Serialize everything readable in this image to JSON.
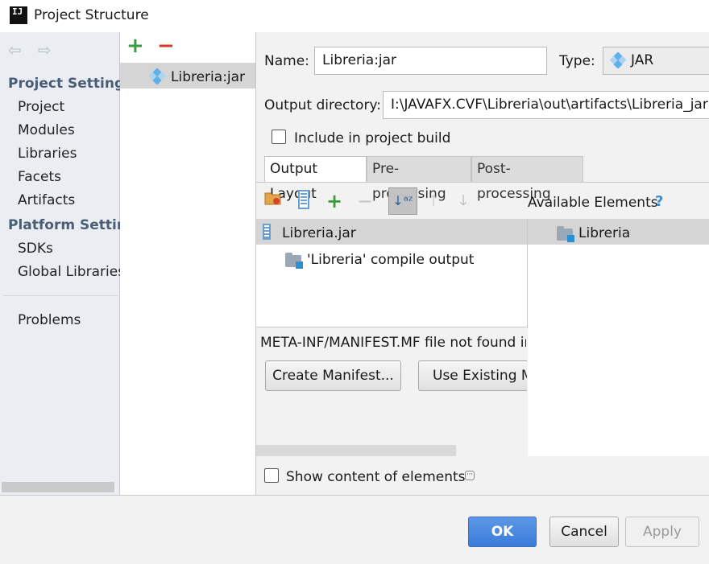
{
  "window": {
    "title": "Project Structure",
    "icon_text": "IJ"
  },
  "nav": {
    "back_icon": "arrow-left-icon",
    "forward_icon": "arrow-right-icon",
    "project_settings_title": "Project Settings",
    "project_settings_items": [
      "Project",
      "Modules",
      "Libraries",
      "Facets",
      "Artifacts"
    ],
    "platform_settings_title": "Platform Settings",
    "platform_settings_items": [
      "SDKs",
      "Global Libraries"
    ],
    "problems_label": "Problems"
  },
  "artifacts_list": {
    "add_icon": "plus-icon",
    "remove_icon": "minus-icon",
    "items": [
      "Libreria:jar"
    ]
  },
  "artifact": {
    "name_label": "Name:",
    "name_value": "Libreria:jar",
    "type_label": "Type:",
    "type_value": "JAR",
    "output_dir_label": "Output directory:",
    "output_dir_value": "I:\\JAVAFX.CVF\\Libreria\\out\\artifacts\\Libreria_jar",
    "include_in_build_label": "Include in project build",
    "include_in_build_checked": false
  },
  "tabs": [
    "Output Layout",
    "Pre-processing",
    "Post-processing"
  ],
  "layout": {
    "available_elements_label": "Available Elements",
    "help_icon": "?",
    "tree_root": "Libreria.jar",
    "tree_child": "'Libreria' compile output",
    "available_items": [
      "Libreria"
    ],
    "manifest_message": "META-INF/MANIFEST.MF file not found in",
    "create_manifest_label": "Create Manifest...",
    "use_existing_label": "Use Existing Manifest...",
    "show_content_label": "Show content of elements",
    "show_content_checked": false
  },
  "footer": {
    "ok_label": "OK",
    "cancel_label": "Cancel",
    "apply_label": "Apply"
  },
  "colors": {
    "accent": "#3c7cd8",
    "selection": "#d5d5d5",
    "section_title": "#4a5d74"
  }
}
